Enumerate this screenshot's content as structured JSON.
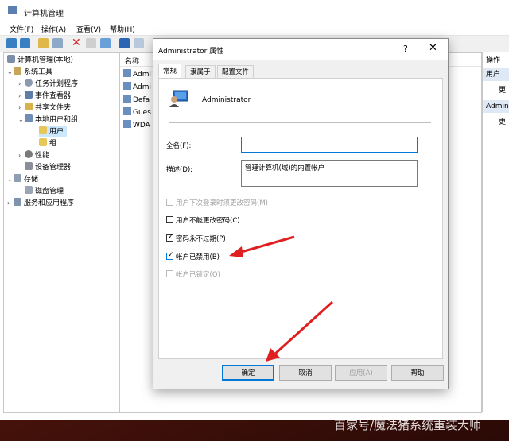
{
  "mmc": {
    "title": "计算机管理",
    "menu": [
      "文件(F)",
      "操作(A)",
      "查看(V)",
      "帮助(H)"
    ]
  },
  "tree": {
    "items": [
      {
        "label": "计算机管理(本地)"
      },
      {
        "label": "系统工具"
      },
      {
        "label": "任务计划程序"
      },
      {
        "label": "事件查看器"
      },
      {
        "label": "共享文件夹"
      },
      {
        "label": "本地用户和组"
      },
      {
        "label": "用户"
      },
      {
        "label": "组"
      },
      {
        "label": "性能"
      },
      {
        "label": "设备管理器"
      },
      {
        "label": "存储"
      },
      {
        "label": "磁盘管理"
      },
      {
        "label": "服务和应用程序"
      }
    ]
  },
  "list": {
    "header": "名称",
    "rows": [
      "Admi",
      "Admi",
      "Defa",
      "Gues",
      "WDA"
    ]
  },
  "actions": {
    "header1": "操作",
    "header2": "用户",
    "item1": "更",
    "header3": "Admin",
    "item2": "更"
  },
  "dialog": {
    "title": "Administrator 属性",
    "help": "?",
    "close": "✕",
    "tabs": [
      "常规",
      "隶属于",
      "配置文件"
    ],
    "user_name": "Administrator",
    "fullname_label": "全名(F):",
    "fullname_value": "",
    "desc_label": "描述(D):",
    "desc_value": "管理计算机(域)的内置帐户",
    "checkboxes": [
      {
        "label": "用户下次登录时须更改密码(M)",
        "checked": false,
        "disabled": true
      },
      {
        "label": "用户不能更改密码(C)",
        "checked": false,
        "disabled": false
      },
      {
        "label": "密码永不过期(P)",
        "checked": true,
        "disabled": false
      },
      {
        "label": "帐户已禁用(B)",
        "checked": true,
        "disabled": false
      },
      {
        "label": "帐户已锁定(O)",
        "checked": false,
        "disabled": true
      }
    ],
    "buttons": {
      "ok": "确定",
      "cancel": "取消",
      "apply": "应用(A)",
      "help": "帮助"
    }
  },
  "watermark": "百家号/魔法猪系统重装大师",
  "colors": {
    "accent": "#0078d7",
    "arrow": "#e02020"
  }
}
